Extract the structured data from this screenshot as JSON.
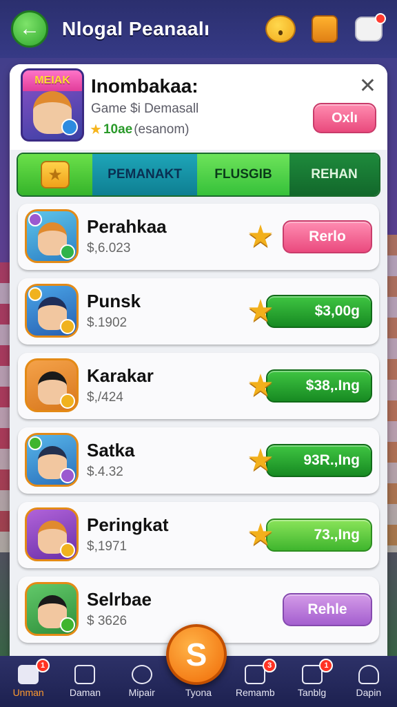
{
  "header": {
    "title": "Nlogal Peanaalı",
    "back_icon": "arrow-left-icon",
    "icons": [
      "smiley-icon",
      "gift-icon",
      "notification-icon"
    ]
  },
  "profile": {
    "badge_text": "MEIAK",
    "name": "Inombakaa:",
    "subtitle": "Game $i Demasall",
    "rating_points": "10ae",
    "rating_text": "(esanom)",
    "action_label": "Oxlı"
  },
  "tabs": [
    {
      "label": ""
    },
    {
      "label": "PEMANAKT"
    },
    {
      "label": "FLUSGIB"
    },
    {
      "label": "REHAN"
    }
  ],
  "rows": [
    {
      "name": "Perahkaa",
      "price": "$,6.023",
      "button": "Rerlo",
      "style": "pink"
    },
    {
      "name": "Punsk",
      "price": "$.1902",
      "button": "$3,00g",
      "style": "green"
    },
    {
      "name": "Karakar",
      "price": "$,/424",
      "button": "$38,.Ing",
      "style": "green"
    },
    {
      "name": "Satka",
      "price": "$.4.32",
      "button": "93R.,Ing",
      "style": "green"
    },
    {
      "name": "Peringkat",
      "price": "$,1971",
      "button": "73.,Ing",
      "style": "lightgreen"
    },
    {
      "name": "Selrbae",
      "price": "$ 3626",
      "button": "Rehle",
      "style": "purple"
    }
  ],
  "fab": {
    "symbol": "S"
  },
  "nav": [
    {
      "label": "Unman",
      "badge": "1",
      "active": true
    },
    {
      "label": "Daman",
      "badge": "",
      "active": false
    },
    {
      "label": "Mipair",
      "badge": "",
      "active": false
    },
    {
      "label": "Tyona",
      "badge": "",
      "active": false
    },
    {
      "label": "Remamb",
      "badge": "3",
      "active": false
    },
    {
      "label": "Tanblg",
      "badge": "1",
      "active": false
    },
    {
      "label": "Dapin",
      "badge": "",
      "active": false
    }
  ],
  "colors": {
    "accent_green": "#35b42a",
    "accent_pink": "#ea4a7e",
    "accent_orange": "#f06a06",
    "nav_bg": "#1d2150"
  }
}
